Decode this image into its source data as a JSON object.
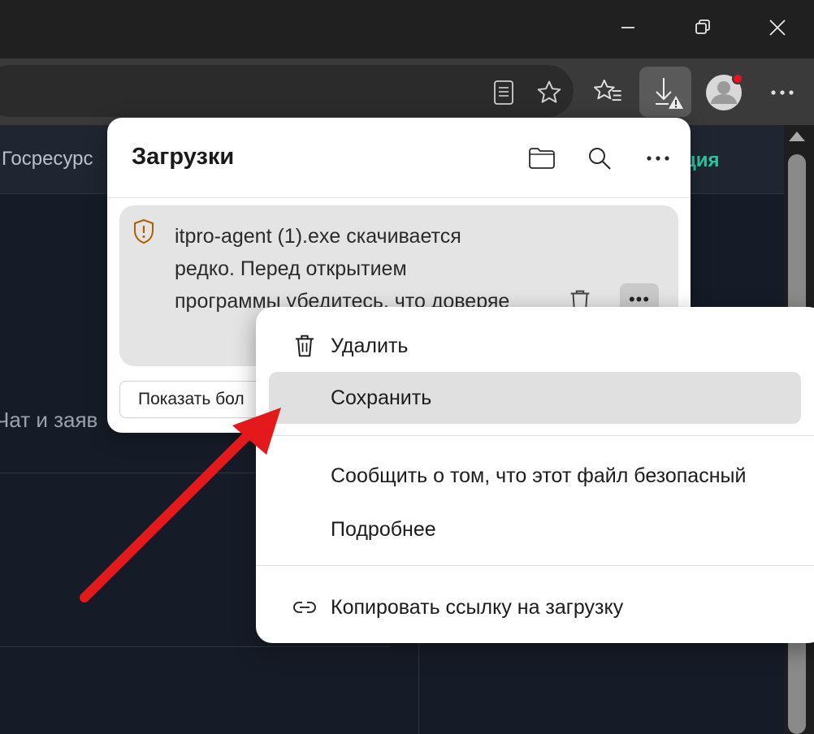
{
  "page": {
    "nav_text": "Госресурс",
    "nav_green": "ция",
    "chat_text": "Чат и заяв"
  },
  "downloads": {
    "title": "Загрузки",
    "item_message": "itpro-agent (1).exe скачивается редко. Перед открытием программы убедитесь, что доверяе",
    "more_glyph": "•••",
    "show_more_label": "Показать бол"
  },
  "menu": {
    "delete": "Удалить",
    "save": "Сохранить",
    "report_safe": "Сообщить о том, что этот файл безопасный",
    "more_info": "Подробнее",
    "copy_link": "Копировать ссылку на загрузку"
  },
  "colors": {
    "accent_green": "#2ec4a0",
    "warning_shield": "#b35c00",
    "annotation_arrow": "#e3191c"
  },
  "icons": [
    "minimize-icon",
    "restore-icon",
    "close-icon",
    "reading-view-icon",
    "star-icon",
    "favorites-icon",
    "download-warning-icon",
    "avatar",
    "more-icon",
    "folder-icon",
    "search-icon",
    "more-icon",
    "shield-warning-icon",
    "trash-icon",
    "link-icon"
  ]
}
